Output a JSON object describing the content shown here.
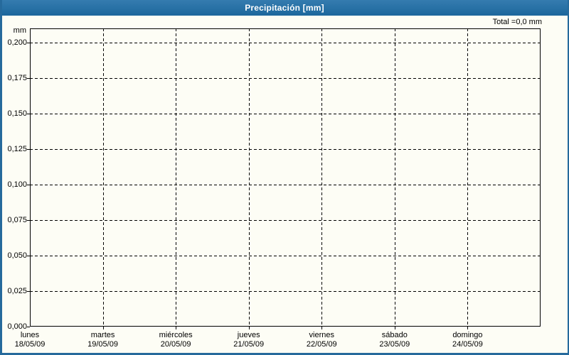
{
  "window": {
    "title": "Precipitación [mm]"
  },
  "chart_data": {
    "type": "bar",
    "title": "Precipitación [mm]",
    "unit_label": "mm",
    "total_label": "Total =0,0 mm",
    "total_mm": 0.0,
    "ylim": [
      0,
      0.21
    ],
    "grid": "dashed",
    "legend": "none",
    "y_ticks": [
      {
        "label": "0,200",
        "value": 0.2
      },
      {
        "label": "0,175",
        "value": 0.175
      },
      {
        "label": "0,150",
        "value": 0.15
      },
      {
        "label": "0,125",
        "value": 0.125
      },
      {
        "label": "0,100",
        "value": 0.1
      },
      {
        "label": "0,075",
        "value": 0.075
      },
      {
        "label": "0,050",
        "value": 0.05
      },
      {
        "label": "0,025",
        "value": 0.025
      },
      {
        "label": "0,000",
        "value": 0.0
      }
    ],
    "categories": [
      {
        "day": "lunes",
        "date": "18/05/09"
      },
      {
        "day": "martes",
        "date": "19/05/09"
      },
      {
        "day": "miércoles",
        "date": "20/05/09"
      },
      {
        "day": "jueves",
        "date": "21/05/09"
      },
      {
        "day": "viernes",
        "date": "22/05/09"
      },
      {
        "day": "sábado",
        "date": "23/05/09"
      },
      {
        "day": "domingo",
        "date": "24/05/09"
      }
    ],
    "values": [
      0,
      0,
      0,
      0,
      0,
      0,
      0
    ]
  },
  "colors": {
    "titlebar": "#1e6da6",
    "border": "#266a9c",
    "background": "#fdfdf5",
    "grid": "#000000",
    "text": "#000000",
    "title_text": "#ffffff"
  }
}
